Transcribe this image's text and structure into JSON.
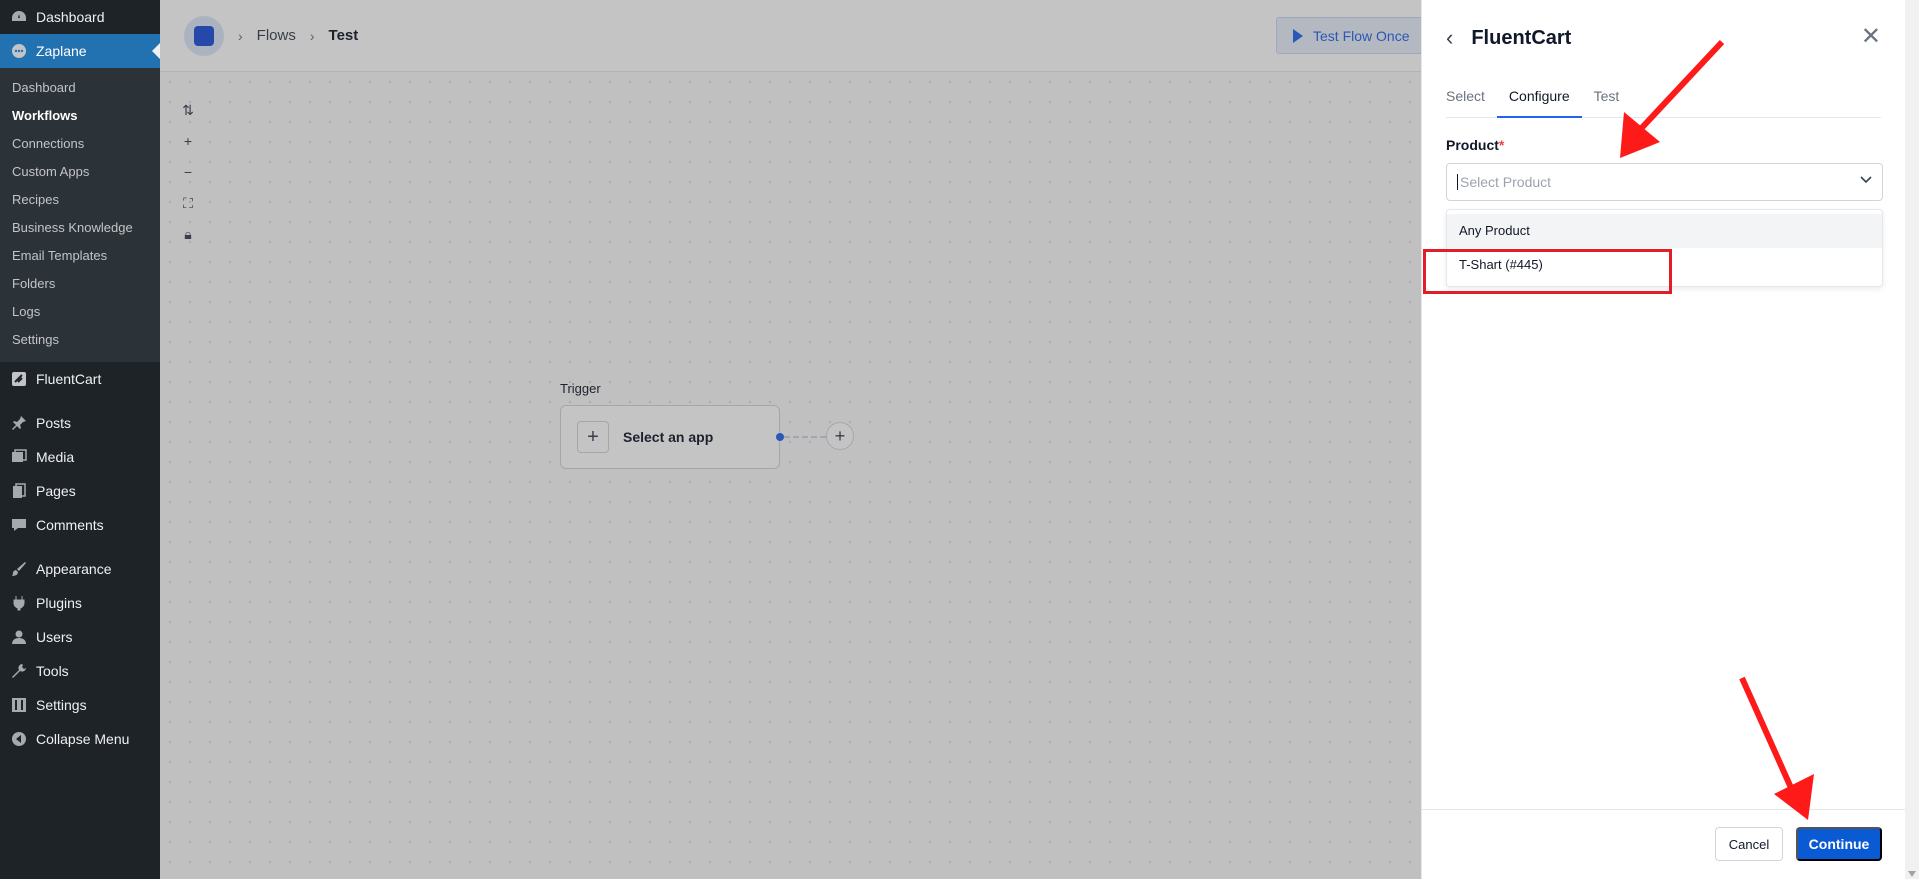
{
  "wp_sidebar": {
    "top_items": [
      {
        "label": "Dashboard",
        "icon": "dashboard-icon"
      },
      {
        "label": "Zaplane",
        "icon": "zaplane-icon",
        "active": true
      }
    ],
    "submenu": [
      "Dashboard",
      "Workflows",
      "Connections",
      "Custom Apps",
      "Recipes",
      "Business Knowledge",
      "Email Templates",
      "Folders",
      "Logs",
      "Settings"
    ],
    "submenu_current": "Workflows",
    "bottom_items": [
      {
        "label": "FluentCart",
        "icon": "fluentcart-icon"
      },
      {
        "label": "Posts",
        "icon": "pin-icon"
      },
      {
        "label": "Media",
        "icon": "media-icon"
      },
      {
        "label": "Pages",
        "icon": "pages-icon"
      },
      {
        "label": "Comments",
        "icon": "comment-icon"
      },
      {
        "label": "Appearance",
        "icon": "brush-icon"
      },
      {
        "label": "Plugins",
        "icon": "plug-icon"
      },
      {
        "label": "Users",
        "icon": "user-icon"
      },
      {
        "label": "Tools",
        "icon": "wrench-icon"
      },
      {
        "label": "Settings",
        "icon": "settings-icon"
      },
      {
        "label": "Collapse Menu",
        "icon": "collapse-icon"
      }
    ]
  },
  "topbar": {
    "breadcrumb": [
      "Flows",
      "Test"
    ],
    "test_button": "Test Flow Once"
  },
  "canvas": {
    "trigger_label": "Trigger",
    "trigger_text": "Select an app"
  },
  "panel": {
    "title": "FluentCart",
    "tabs": [
      "Select",
      "Configure",
      "Test"
    ],
    "active_tab": "Configure",
    "field_label": "Product",
    "required_mark": "*",
    "select_placeholder": "Select Product",
    "options": [
      "Any Product",
      "T-Shart (#445)"
    ],
    "cancel": "Cancel",
    "continue": "Continue"
  },
  "colors": {
    "accent": "#0a5ad4",
    "wp_sidebar": "#1d2327",
    "wp_active": "#2271b1",
    "annotation": "#e11d2a"
  }
}
